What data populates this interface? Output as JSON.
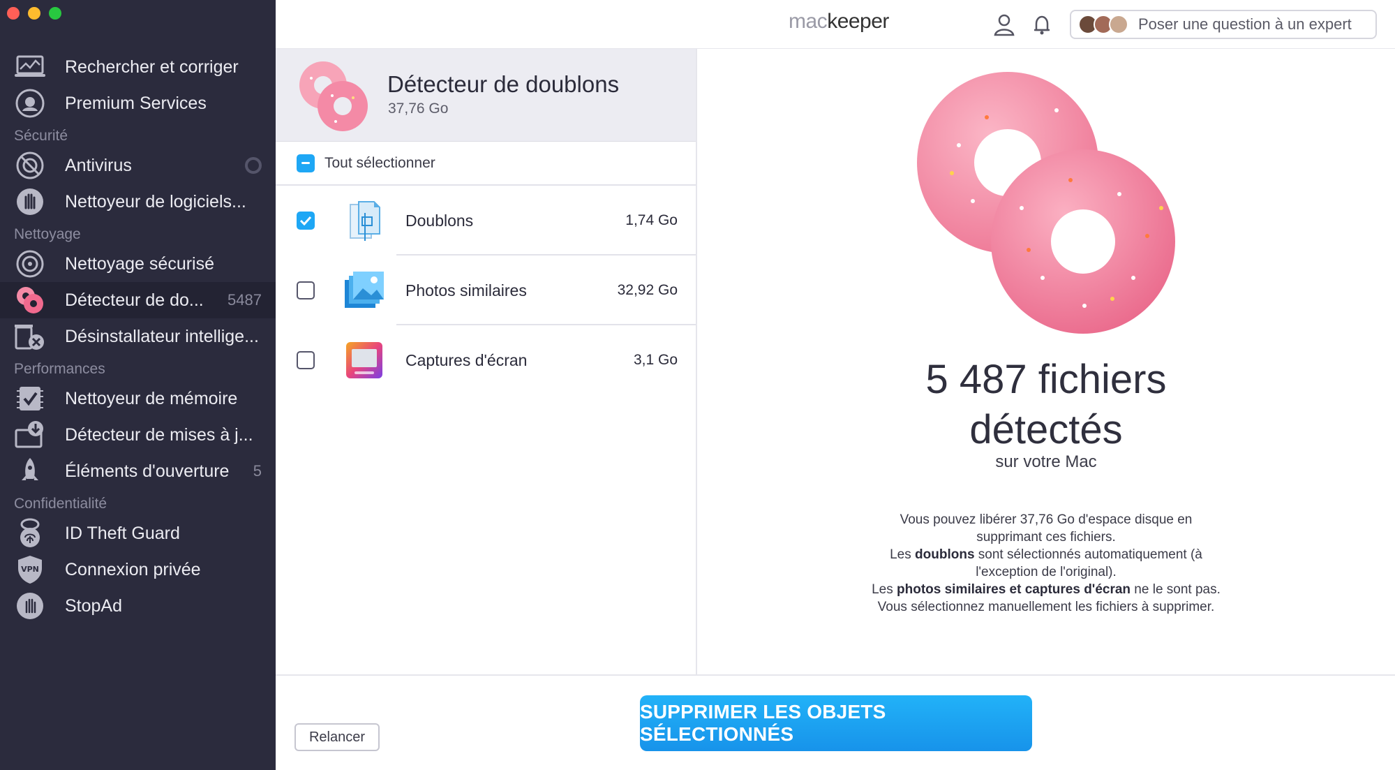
{
  "window": {
    "controls": [
      "close",
      "minimize",
      "zoom"
    ]
  },
  "sidebar": {
    "items": [
      {
        "label": "Rechercher et corriger",
        "icon": "laptop-scan-icon"
      },
      {
        "label": "Premium Services",
        "icon": "headset-icon"
      },
      {
        "section": "Sécurité"
      },
      {
        "label": "Antivirus",
        "icon": "antivirus-icon",
        "toggle": "off"
      },
      {
        "label": "Nettoyeur de logiciels...",
        "icon": "hand-stop-icon"
      },
      {
        "section": "Nettoyage"
      },
      {
        "label": "Nettoyage sécurisé",
        "icon": "disk-clean-icon"
      },
      {
        "label": "Détecteur de do...",
        "icon": "donut-icon",
        "badge": "5487",
        "active": true
      },
      {
        "label": "Désinstallateur intellige...",
        "icon": "uninstall-icon"
      },
      {
        "section": "Performances"
      },
      {
        "label": "Nettoyeur de mémoire",
        "icon": "memory-icon"
      },
      {
        "label": "Détecteur de mises à j...",
        "icon": "update-icon"
      },
      {
        "label": "Éléments d'ouverture",
        "icon": "rocket-icon",
        "badge": "5"
      },
      {
        "section": "Confidentialité"
      },
      {
        "label": "ID Theft Guard",
        "icon": "fingerprint-icon"
      },
      {
        "label": "Connexion privée",
        "icon": "vpn-shield-icon"
      },
      {
        "label": "StopAd",
        "icon": "stopad-hand-icon"
      }
    ]
  },
  "topbar": {
    "brand_mac": "mac",
    "brand_keeper": "keeper",
    "ask_expert": "Poser une question à un expert"
  },
  "panel": {
    "title": "Détecteur de doublons",
    "size": "37,76 Go",
    "select_all": "Tout sélectionner",
    "rows": [
      {
        "label": "Doublons",
        "size": "1,74 Go",
        "checked": true,
        "icon": "duplicate-files-icon"
      },
      {
        "label": "Photos similaires",
        "size": "32,92 Go",
        "checked": false,
        "icon": "similar-photos-icon"
      },
      {
        "label": "Captures d'écran",
        "size": "3,1 Go",
        "checked": false,
        "icon": "screenshot-icon"
      }
    ]
  },
  "summary": {
    "count_line1": "5 487 fichiers",
    "count_line2": "détectés",
    "on_mac": "sur votre Mac",
    "desc_1": "Vous pouvez libérer 37,76 Go d'espace disque en supprimant ces fichiers.",
    "desc_2a": "Les ",
    "desc_2b": "doublons",
    "desc_2c": " sont sélectionnés automatiquement (à l'exception de l'original).",
    "desc_3a": "Les ",
    "desc_3b": "photos similaires et captures d'écran",
    "desc_3c": " ne le sont pas. Vous sélectionnez manuellement les fichiers à supprimer."
  },
  "footer": {
    "rescan": "Relancer",
    "delete": "SUPPRIMER LES OBJETS SÉLECTIONNÉS"
  },
  "colors": {
    "sidebar_bg": "#2b2b3d",
    "accent_blue": "#1ea7f5",
    "donut_pink": "#f48aa6"
  }
}
